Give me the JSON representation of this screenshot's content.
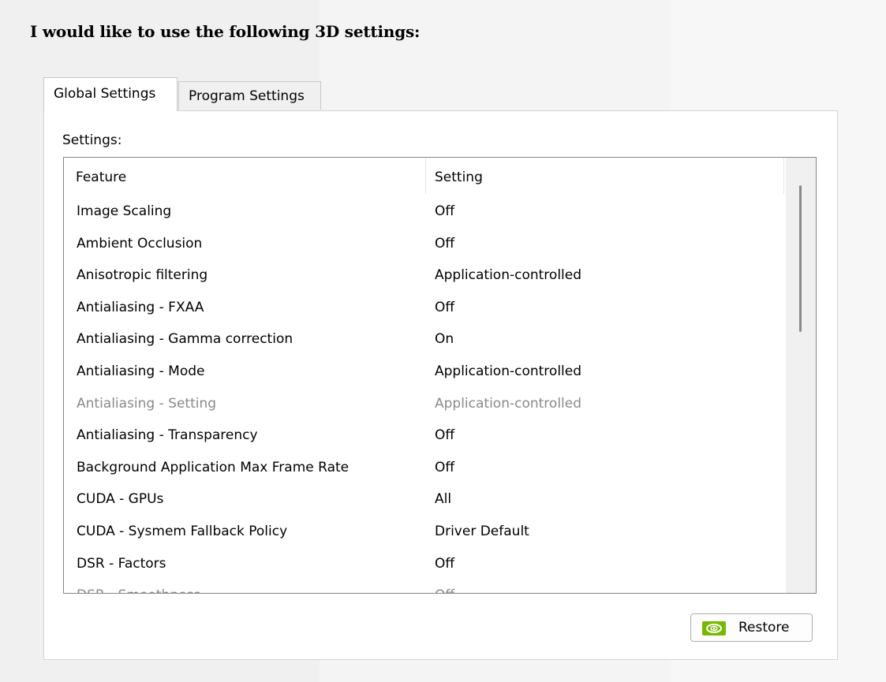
{
  "page": {
    "heading": "I would like to use the following 3D settings:"
  },
  "tabs": [
    {
      "label": "Global Settings",
      "selected": true
    },
    {
      "label": "Program Settings",
      "selected": false
    }
  ],
  "settings_panel": {
    "label": "Settings:",
    "columns": [
      "Feature",
      "Setting"
    ],
    "rows": [
      {
        "feature": "Image Scaling",
        "setting": "Off",
        "enabled": true
      },
      {
        "feature": "Ambient Occlusion",
        "setting": "Off",
        "enabled": true
      },
      {
        "feature": "Anisotropic filtering",
        "setting": "Application-controlled",
        "enabled": true
      },
      {
        "feature": "Antialiasing - FXAA",
        "setting": "Off",
        "enabled": true
      },
      {
        "feature": "Antialiasing - Gamma correction",
        "setting": "On",
        "enabled": true
      },
      {
        "feature": "Antialiasing - Mode",
        "setting": "Application-controlled",
        "enabled": true
      },
      {
        "feature": "Antialiasing - Setting",
        "setting": "Application-controlled",
        "enabled": false
      },
      {
        "feature": "Antialiasing - Transparency",
        "setting": "Off",
        "enabled": true
      },
      {
        "feature": "Background Application Max Frame Rate",
        "setting": "Off",
        "enabled": true
      },
      {
        "feature": "CUDA - GPUs",
        "setting": "All",
        "enabled": true
      },
      {
        "feature": "CUDA - Sysmem Fallback Policy",
        "setting": "Driver Default",
        "enabled": true
      },
      {
        "feature": "DSR - Factors",
        "setting": "Off",
        "enabled": true
      },
      {
        "feature": "DSR - Smoothness",
        "setting": "Off",
        "enabled": false
      }
    ]
  },
  "restore_button": {
    "label": "Restore",
    "icon": "nvidia-logo-icon"
  },
  "colors": {
    "nvidia_green": "#76b900",
    "disabled_text": "#8a8a8a"
  }
}
